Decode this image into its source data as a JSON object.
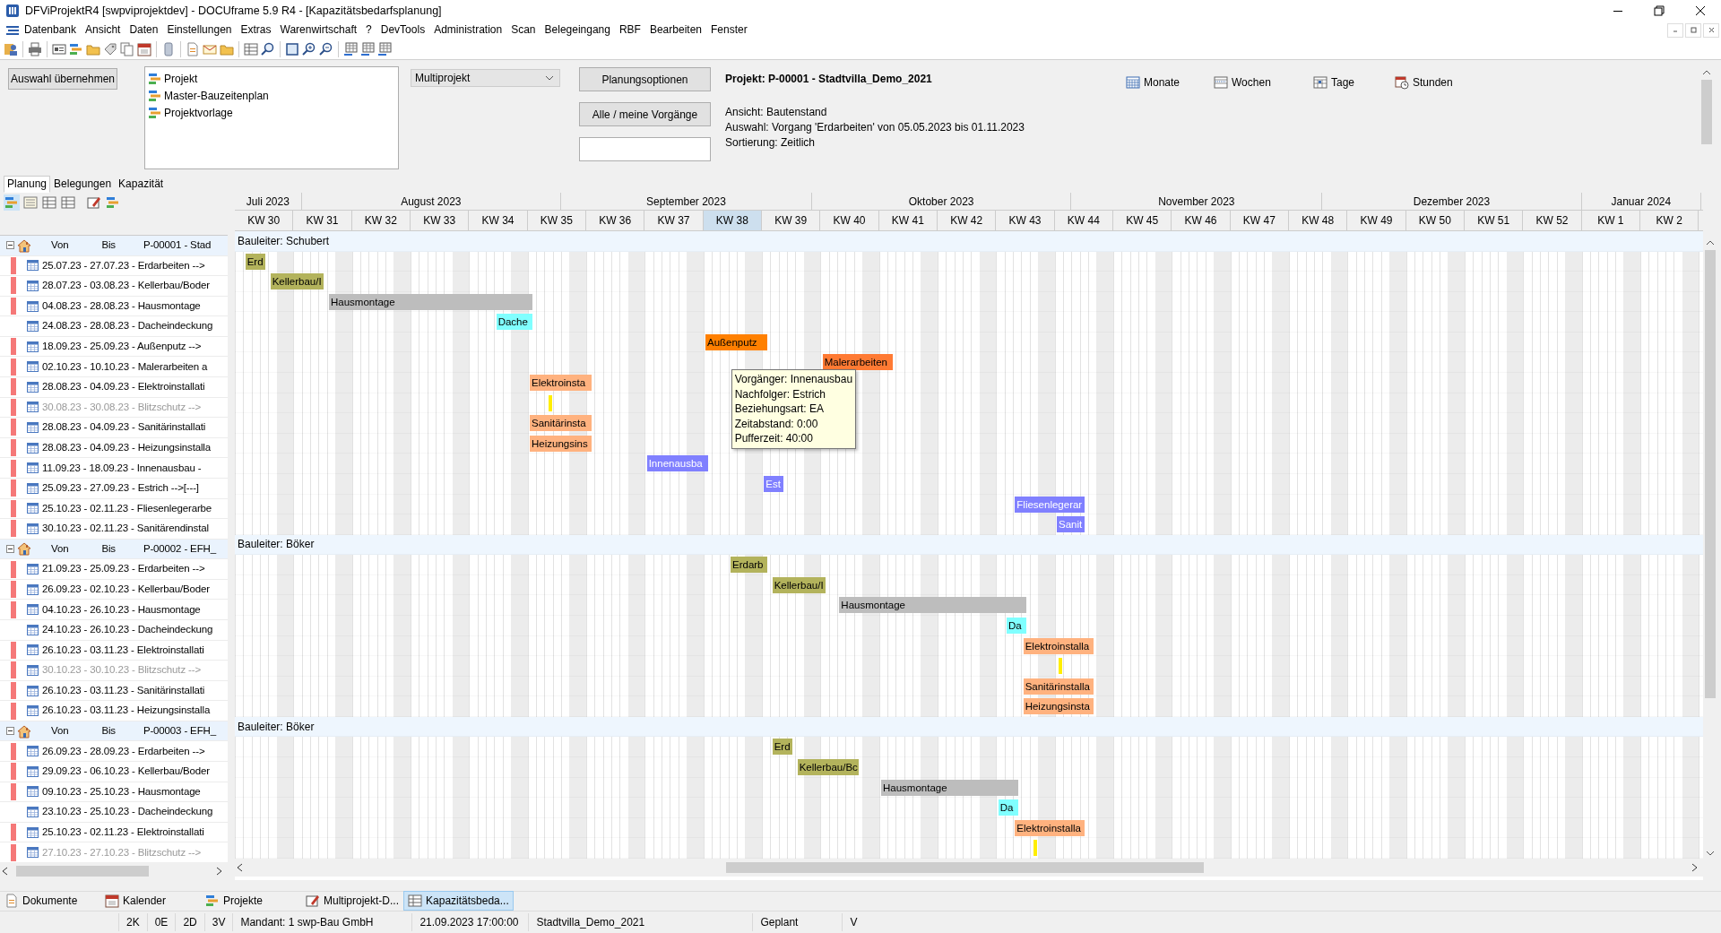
{
  "window": {
    "title": "DFViProjektR4 [swpviprojektdev] - DOCUframe 5.9 R4 - [Kapazitätsbedarfsplanung]"
  },
  "menu": [
    "Datenbank",
    "Ansicht",
    "Daten",
    "Einstellungen",
    "Extras",
    "Warenwirtschaft",
    "?",
    "DevTools",
    "Administration",
    "Scan",
    "Belegeingang",
    "RBF",
    "Bearbeiten",
    "Fenster"
  ],
  "top_panel": {
    "apply_button": "Auswahl übernehmen",
    "plan_types": [
      "Projekt",
      "Master-Bauzeitenplan",
      "Projektvorlage"
    ],
    "mode_select": "Multiprojekt",
    "options_button": "Planungsoptionen",
    "filter_button": "Alle / meine Vorgänge",
    "project_title": "Projekt: P-00001 - Stadtvilla_Demo_2021",
    "info_lines": [
      "Ansicht: Bautenstand",
      "Auswahl: Vorgang 'Erdarbeiten' von 05.05.2023 bis 01.11.2023",
      "Sortierung: Zeitlich"
    ],
    "scale_buttons": [
      "Monate",
      "Wochen",
      "Tage",
      "Stunden"
    ]
  },
  "tabs": [
    {
      "label": "Planung",
      "selected": true
    },
    {
      "label": "Belegungen",
      "selected": false
    },
    {
      "label": "Kapazität",
      "selected": false
    }
  ],
  "timeline": {
    "months": [
      "Juli 2023",
      "August 2023",
      "September 2023",
      "Oktober 2023",
      "November 2023",
      "Dezember 2023",
      "Januar 2024"
    ],
    "weeks": [
      {
        "label": "KW 30",
        "selected": false
      },
      {
        "label": "KW 31",
        "selected": false
      },
      {
        "label": "KW 32",
        "selected": false
      },
      {
        "label": "KW 33",
        "selected": false
      },
      {
        "label": "KW 34",
        "selected": false
      },
      {
        "label": "KW 35",
        "selected": false
      },
      {
        "label": "KW 36",
        "selected": false
      },
      {
        "label": "KW 37",
        "selected": false
      },
      {
        "label": "KW 38",
        "selected": true
      },
      {
        "label": "KW 39",
        "selected": false
      },
      {
        "label": "KW 40",
        "selected": false
      },
      {
        "label": "KW 41",
        "selected": false
      },
      {
        "label": "KW 42",
        "selected": false
      },
      {
        "label": "KW 43",
        "selected": false
      },
      {
        "label": "KW 44",
        "selected": false
      },
      {
        "label": "KW 45",
        "selected": false
      },
      {
        "label": "KW 46",
        "selected": false
      },
      {
        "label": "KW 47",
        "selected": false
      },
      {
        "label": "KW 48",
        "selected": false
      },
      {
        "label": "KW 49",
        "selected": false
      },
      {
        "label": "KW 50",
        "selected": false
      },
      {
        "label": "KW 51",
        "selected": false
      },
      {
        "label": "KW 52",
        "selected": false
      },
      {
        "label": "KW 1",
        "selected": false
      },
      {
        "label": "KW 2",
        "selected": false
      }
    ]
  },
  "projects": [
    {
      "header": {
        "von": "Von",
        "bis": "Bis",
        "project": "P-00001 - Stad"
      },
      "lane_label": "Bauleiter: Schubert",
      "tasks": [
        {
          "text": "25.07.23 - 27.07.23 - Erdarbeiten   -->",
          "critical": true,
          "disabled": false,
          "kind": "bar",
          "bar_label": "Erd",
          "color": "#b3b35c"
        },
        {
          "text": "28.07.23 - 03.08.23 - Kellerbau/Boder",
          "critical": true,
          "disabled": false,
          "kind": "bar",
          "bar_label": "Kellerbau/I",
          "color": "#b3b35c"
        },
        {
          "text": "04.08.23 - 28.08.23 - Hausmontage",
          "critical": true,
          "disabled": false,
          "kind": "bar",
          "bar_label": "Hausmontage",
          "color": "#bdbdbd"
        },
        {
          "text": "24.08.23 - 28.08.23 - Dacheindeckung",
          "critical": false,
          "disabled": false,
          "kind": "bar",
          "bar_label": "Dache",
          "color": "#80ffff"
        },
        {
          "text": "18.09.23 - 25.09.23 - Außenputz   -->",
          "critical": true,
          "disabled": false,
          "kind": "bar",
          "bar_label": "Außenputz",
          "color": "#ff8000"
        },
        {
          "text": "02.10.23 - 10.10.23 - Malerarbeiten a",
          "critical": true,
          "disabled": false,
          "kind": "bar",
          "bar_label": "Malerarbeiten",
          "color": "#ff7a33"
        },
        {
          "text": "28.08.23 - 04.09.23 - Elektroinstallati",
          "critical": true,
          "disabled": false,
          "kind": "bar",
          "bar_label": "Elektroinsta",
          "color": "#ffb27f"
        },
        {
          "text": "30.08.23 - 30.08.23 - Blitzschutz   -->",
          "critical": true,
          "disabled": true,
          "kind": "milestone",
          "color": "#ffee00"
        },
        {
          "text": "28.08.23 - 04.09.23 - Sanitärinstallati",
          "critical": true,
          "disabled": false,
          "kind": "bar",
          "bar_label": "Sanitärinsta",
          "color": "#ffb27f"
        },
        {
          "text": "28.08.23 - 04.09.23 - Heizungsinstalla",
          "critical": true,
          "disabled": false,
          "kind": "bar",
          "bar_label": "Heizungsins",
          "color": "#ffb27f"
        },
        {
          "text": "11.09.23 - 18.09.23 - Innenausbau   -",
          "critical": true,
          "disabled": false,
          "kind": "bar",
          "bar_label": "Innenausba",
          "color": "#8080ff"
        },
        {
          "text": "25.09.23 - 27.09.23 - Estrich   -->[---]",
          "critical": true,
          "disabled": false,
          "kind": "bar",
          "bar_label": "Est",
          "color": "#8080ff"
        },
        {
          "text": "25.10.23 - 02.11.23 - Fliesenlegerarbe",
          "critical": true,
          "disabled": false,
          "kind": "bar",
          "bar_label": "Fliesenlegerar",
          "color": "#8080ff"
        },
        {
          "text": "30.10.23 - 02.11.23 - Sanitärendinstal",
          "critical": true,
          "disabled": false,
          "kind": "bar",
          "bar_label": "Sanit",
          "color": "#8080ff"
        }
      ]
    },
    {
      "header": {
        "von": "Von",
        "bis": "Bis",
        "project": "P-00002 - EFH_"
      },
      "lane_label": "Bauleiter: Böker",
      "tasks": [
        {
          "text": "21.09.23 - 25.09.23 - Erdarbeiten   -->",
          "critical": true,
          "disabled": false,
          "kind": "bar",
          "bar_label": "Erdarb",
          "color": "#b3b35c"
        },
        {
          "text": "26.09.23 - 02.10.23 - Kellerbau/Boder",
          "critical": true,
          "disabled": false,
          "kind": "bar",
          "bar_label": "Kellerbau/I",
          "color": "#b3b35c"
        },
        {
          "text": "04.10.23 - 26.10.23 - Hausmontage",
          "critical": true,
          "disabled": false,
          "kind": "bar",
          "bar_label": "Hausmontage",
          "color": "#bdbdbd"
        },
        {
          "text": "24.10.23 - 26.10.23 - Dacheindeckung",
          "critical": false,
          "disabled": false,
          "kind": "bar",
          "bar_label": "Da",
          "color": "#80ffff"
        },
        {
          "text": "26.10.23 - 03.11.23 - Elektroinstallati",
          "critical": true,
          "disabled": false,
          "kind": "bar",
          "bar_label": "Elektroinstalla",
          "color": "#ffb27f"
        },
        {
          "text": "30.10.23 - 30.10.23 - Blitzschutz   -->",
          "critical": true,
          "disabled": true,
          "kind": "milestone",
          "color": "#ffee00"
        },
        {
          "text": "26.10.23 - 03.11.23 - Sanitärinstallati",
          "critical": true,
          "disabled": false,
          "kind": "bar",
          "bar_label": "Sanitärinstalla",
          "color": "#ffb27f"
        },
        {
          "text": "26.10.23 - 03.11.23 - Heizungsinstalla",
          "critical": true,
          "disabled": false,
          "kind": "bar",
          "bar_label": "Heizungsinsta",
          "color": "#ffb27f"
        }
      ]
    },
    {
      "header": {
        "von": "Von",
        "bis": "Bis",
        "project": "P-00003 - EFH_"
      },
      "lane_label": "Bauleiter: Böker",
      "tasks": [
        {
          "text": "26.09.23 - 28.09.23 - Erdarbeiten   -->",
          "critical": true,
          "disabled": false,
          "kind": "bar",
          "bar_label": "Erd",
          "color": "#b3b35c"
        },
        {
          "text": "29.09.23 - 06.10.23 - Kellerbau/Boder",
          "critical": true,
          "disabled": false,
          "kind": "bar",
          "bar_label": "Kellerbau/Bc",
          "color": "#b3b35c"
        },
        {
          "text": "09.10.23 - 25.10.23 - Hausmontage",
          "critical": true,
          "disabled": false,
          "kind": "bar",
          "bar_label": "Hausmontage",
          "color": "#bdbdbd"
        },
        {
          "text": "23.10.23 - 25.10.23 - Dacheindeckung",
          "critical": false,
          "disabled": false,
          "kind": "bar",
          "bar_label": "Da",
          "color": "#80ffff"
        },
        {
          "text": "25.10.23 - 02.11.23 - Elektroinstallati",
          "critical": true,
          "disabled": false,
          "kind": "bar",
          "bar_label": "Elektroinstalla",
          "color": "#ffb27f"
        },
        {
          "text": "27.10.23 - 27.10.23 - Blitzschutz   -->",
          "critical": true,
          "disabled": true,
          "kind": "milestone",
          "color": "#ffee00"
        }
      ]
    }
  ],
  "tooltip": {
    "lines": [
      "Vorgänger: Innenausbau",
      "Nachfolger: Estrich",
      "Beziehungsart: EA",
      "Zeitabstand: 0:00",
      "Pufferzeit: 40:00"
    ]
  },
  "bottom_tabs": [
    {
      "label": "Dokumente",
      "selected": false
    },
    {
      "label": "Kalender",
      "selected": false
    },
    {
      "label": "Projekte",
      "selected": false
    },
    {
      "label": "Multiprojekt-D...",
      "selected": false
    },
    {
      "label": "Kapazitätsbeda...",
      "selected": true
    }
  ],
  "status_bar": [
    "2K",
    "0E",
    "2D",
    "3V",
    "Mandant: 1 swp-Bau GmbH",
    "21.09.2023 17:00:00",
    "Stadtvilla_Demo_2021",
    "Geplant",
    "V"
  ]
}
